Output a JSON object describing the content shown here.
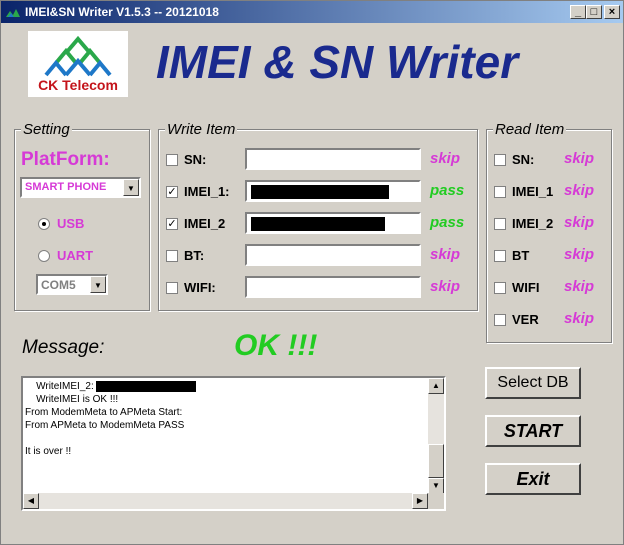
{
  "window": {
    "title": "IMEI&SN Writer V1.5.3 -- 20121018",
    "controls": {
      "minimize": "_",
      "maximize": "□",
      "close": "×"
    }
  },
  "logo": {
    "text": "CK Telecom",
    "icon": "ck-telecom-logo-icon",
    "colors": {
      "green": "#2aa84a",
      "blue": "#1e78c8",
      "red": "#c4141b"
    }
  },
  "app_title": "IMEI & SN Writer",
  "setting": {
    "label": "Setting",
    "platform_label": "PlatForm:",
    "platform_value": "SMART PHONE",
    "usb_label": "USB",
    "uart_label": "UART",
    "usb_selected": true,
    "com_port": "COM5"
  },
  "write": {
    "label": "Write Item",
    "items": [
      {
        "label": "SN:",
        "checked": false,
        "status": "skip"
      },
      {
        "label": "IMEI_1:",
        "checked": true,
        "status": "pass"
      },
      {
        "label": "IMEI_2",
        "checked": true,
        "status": "pass"
      },
      {
        "label": "BT:",
        "checked": false,
        "status": "skip"
      },
      {
        "label": "WIFI:",
        "checked": false,
        "status": "skip"
      }
    ]
  },
  "read": {
    "label": "Read Item",
    "items": [
      {
        "label": "SN:",
        "checked": false,
        "status": "skip"
      },
      {
        "label": "IMEI_1",
        "checked": false,
        "status": "skip"
      },
      {
        "label": "IMEI_2",
        "checked": false,
        "status": "skip"
      },
      {
        "label": "BT",
        "checked": false,
        "status": "skip"
      },
      {
        "label": "WIFI",
        "checked": false,
        "status": "skip"
      },
      {
        "label": "VER",
        "checked": false,
        "status": "skip"
      }
    ]
  },
  "message": {
    "label": "Message:",
    "result": "OK !!!",
    "log": [
      "    WriteIMEI_2:",
      "    WriteIMEI is OK !!!",
      "From ModemMeta to APMeta Start:",
      "From APMeta to ModemMeta PASS",
      "",
      "It is over !!"
    ]
  },
  "buttons": {
    "select_db": "Select DB",
    "start": "START",
    "exit": "Exit"
  },
  "colors": {
    "pass": "#22cc22",
    "skip": "#d63ad6",
    "title": "#1a2a8e",
    "titlebar": "#0a246a"
  }
}
